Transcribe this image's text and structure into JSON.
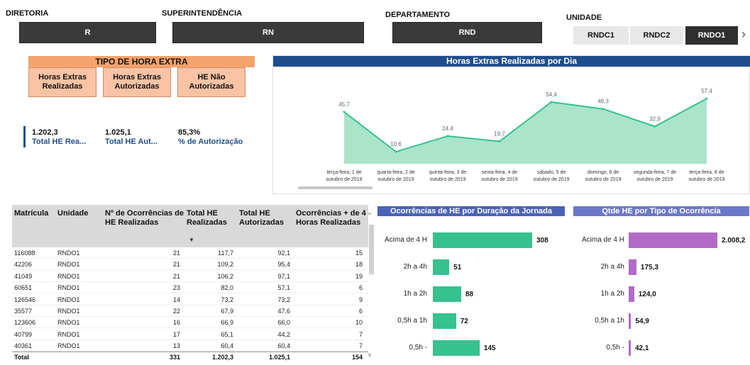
{
  "filters": {
    "diretoria": {
      "label": "DIRETORIA",
      "value": "R"
    },
    "superintendencia": {
      "label": "SUPERINTENDÊNCIA",
      "value": "RN"
    },
    "departamento": {
      "label": "DEPARTAMENTO",
      "value": "RND"
    },
    "unidade": {
      "label": "UNIDADE",
      "options": [
        "RNDC1",
        "RNDC2",
        "RNDO1"
      ],
      "selected": "RNDO1"
    }
  },
  "tipo_hora_extra": {
    "title": "TIPO DE HORA EXTRA",
    "buttons": [
      "Horas Extras Realizadas",
      "Horas Extras Autorizadas",
      "HE Não Autorizadas"
    ]
  },
  "kpis": [
    {
      "value": "1.202,3",
      "label": "Total HE Rea..."
    },
    {
      "value": "1.025,1",
      "label": "Total HE Aut..."
    },
    {
      "value": "85,3%",
      "label": "% de Autorização"
    }
  ],
  "colors": {
    "accent_blue": "#1f4e8c",
    "teal": "#36c18e",
    "area": "#a9e4cb",
    "purple": "#b16bc6",
    "orange": "#f4a36b",
    "panel_blue": "#4a63b8",
    "panel_purple": "#6b78c9"
  },
  "line_chart": {
    "title": "Horas Extras Realizadas por Dia",
    "chart_data": {
      "type": "area",
      "categories": [
        "terça-feira, 1 de outubro de 2019",
        "quarta-feira, 2 de outubro de 2019",
        "quinta-feira, 3 de outubro de 2019",
        "sexta-feira, 4 de outubro de 2019",
        "sábado, 5 de outubro de 2019",
        "domingo, 6 de outubro de 2019",
        "segunda-feira, 7 de outubro de 2019",
        "terça-feira, 8 de outubro de 2019"
      ],
      "values": [
        45.7,
        10.6,
        24.4,
        19.7,
        54.4,
        48.3,
        32.9,
        57.4
      ],
      "labels": [
        "45,7",
        "10,6",
        "24,4",
        "19,7",
        "54,4",
        "48,3",
        "32,9",
        "57,4"
      ]
    }
  },
  "table": {
    "headers": [
      "Matrícula",
      "Unidade",
      "Nº de Ocorrências de HE Realizadas",
      "Total HE Realizadas",
      "Total HE Autorizadas",
      "Ocorrências + de 4 Horas Realizadas"
    ],
    "rows": [
      [
        "116088",
        "RNDO1",
        "21",
        "117,7",
        "92,1",
        "15"
      ],
      [
        "42206",
        "RNDO1",
        "21",
        "109,2",
        "95,4",
        "18"
      ],
      [
        "41049",
        "RNDO1",
        "21",
        "106,2",
        "97,1",
        "19"
      ],
      [
        "60651",
        "RNDO1",
        "23",
        "82,0",
        "57,1",
        "6"
      ],
      [
        "126546",
        "RNDO1",
        "14",
        "73,2",
        "73,2",
        "9"
      ],
      [
        "35577",
        "RNDO1",
        "22",
        "67,9",
        "47,6",
        "6"
      ],
      [
        "123606",
        "RNDO1",
        "16",
        "66,9",
        "66,0",
        "10"
      ],
      [
        "40799",
        "RNDO1",
        "17",
        "65,1",
        "44,2",
        "7"
      ],
      [
        "40361",
        "RNDO1",
        "13",
        "60,4",
        "60,4",
        "7"
      ]
    ],
    "total": [
      "Total",
      "",
      "331",
      "1.202,3",
      "1.025,1",
      "154"
    ]
  },
  "bar_chart_1": {
    "title": "Ocorrências de HE por Duração da Jornada",
    "chart_data": {
      "type": "bar",
      "categories": [
        "Acima de 4 H",
        "2h a 4h",
        "1h a 2h",
        "0,5h a 1h",
        "0,5h -"
      ],
      "values": [
        308,
        51,
        88,
        72,
        145
      ],
      "labels": [
        "308",
        "51",
        "88",
        "72",
        "145"
      ]
    }
  },
  "bar_chart_2": {
    "title": "Qtde HE por Tipo de Ocorrência",
    "chart_data": {
      "type": "bar",
      "categories": [
        "Acima de 4 H",
        "2h a 4h",
        "1h a 2h",
        "0,5h a 1h",
        "0,5h -"
      ],
      "values": [
        2008.2,
        175.3,
        124.0,
        54.9,
        42.1
      ],
      "labels": [
        "2.008,2",
        "175,3",
        "124,0",
        "54,9",
        "42,1"
      ]
    }
  }
}
